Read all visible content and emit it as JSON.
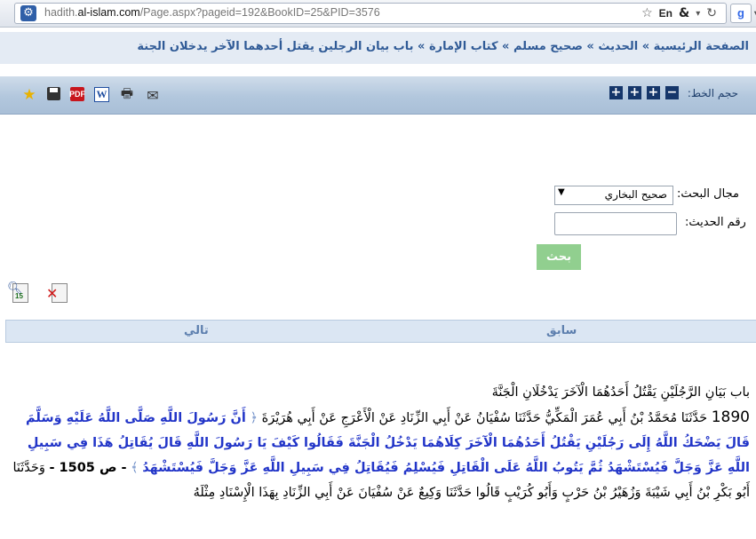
{
  "browser": {
    "url_prefix": "hadith.",
    "url_host": "al-islam.com",
    "url_path": "/Page.aspx?pageid=192&BookID=25&PID=3576",
    "lang_label": "En"
  },
  "breadcrumb": {
    "items": [
      "الصفحة الرئيسية",
      "الحديث",
      "صحيح مسلم",
      "كتاب الإمارة",
      "باب بيان الرجلين يقتل أحدهما الآخر يدخلان الجنة"
    ],
    "separator": " » "
  },
  "toolbar": {
    "font_size_label": "حجم الخط:",
    "decrease": "−",
    "increase": "+",
    "icons": [
      "star-icon",
      "save-icon",
      "pdf-icon",
      "word-icon",
      "print-icon",
      "mail-icon"
    ]
  },
  "search": {
    "field_label": "مجال البحث:",
    "selected_source": "صحيح البخاري",
    "number_label": "رقم الحديث:",
    "number_value": "",
    "button_label": "بحث"
  },
  "navigation": {
    "previous": "سابق",
    "next": "تالي"
  },
  "hadith": {
    "chapter_title": "باب بَيَانِ الرَّجُلَيْنِ يَقْتُلُ أَحَدُهُمَا الْآخَرَ يَدْخُلَانِ الْجَنَّةَ",
    "number": "1890",
    "isnad": "حَدَّثَنَا مُحَمَّدُ بْنُ أَبِي عُمَرَ الْمَكِّيُّ حَدَّثَنَا سُفْيَانُ عَنْ أَبِي الزِّنَادِ عَنْ الْأَعْرَجِ عَنْ أَبِي هُرَيْرَةَ",
    "open_quote": "﴿",
    "matn": "أَنَّ رَسُولَ اللَّهِ صَلَّى اللَّهُ عَلَيْهِ وَسَلَّمَ قَالَ يَضْحَكُ اللَّهُ إِلَى رَجُلَيْنِ يَقْتُلُ أَحَدُهُمَا الْآخَرَ كِلَاهُمَا يَدْخُلُ الْجَنَّةَ فَقَالُوا كَيْفَ يَا رَسُولَ اللَّهِ قَالَ يُقَاتِلُ هَذَا فِي سَبِيلِ اللَّهِ عَزَّ وَجَلَّ فَيُسْتَشْهَدُ ثُمَّ يَتُوبُ اللَّهُ عَلَى الْقَاتِلِ فَيُسْلِمُ فَيُقَاتِلُ فِي سَبِيلِ اللَّهِ عَزَّ وَجَلَّ فَيُسْتَشْهَدُ",
    "close_quote": "﴾",
    "page_ref": "- ص 1505 -",
    "continuation": "وَحَدَّثَنَا أَبُو بَكْرِ بْنُ أَبِي شَيْبَةَ وَزُهَيْرُ بْنُ حَرْبٍ وَأَبُو كُرَيْبٍ قَالُوا حَدَّثَنَا وَكِيعٌ عَنْ سُفْيَانَ عَنْ أَبِي الزِّنَادِ بِهَذَا الْإِسْنَادِ مِثْلَهُ"
  }
}
